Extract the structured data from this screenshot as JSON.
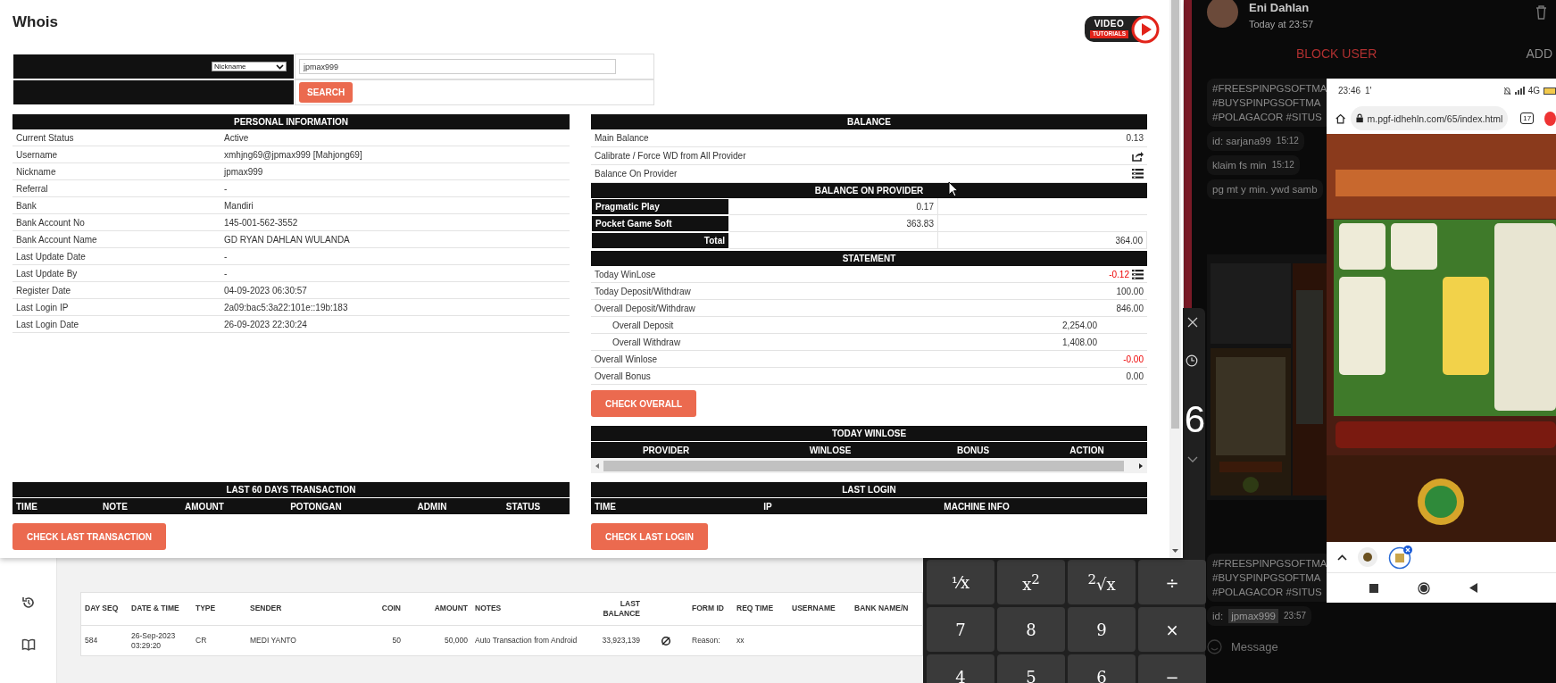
{
  "dialog": {
    "title": "Whois",
    "logo": {
      "top": "VIDEO",
      "bottom": "TUTORIALS"
    },
    "search": {
      "type": "Nickname",
      "value": "jpmax999",
      "button": "SEARCH"
    },
    "personal": {
      "title": "PERSONAL INFORMATION",
      "rows": [
        {
          "label": "Current Status",
          "value": "Active"
        },
        {
          "label": "Username",
          "value": "xmhjng69@jpmax999  [Mahjong69]"
        },
        {
          "label": "Nickname",
          "value": "jpmax999"
        },
        {
          "label": "Referral",
          "value": "-"
        },
        {
          "label": "Bank",
          "value": "Mandiri"
        },
        {
          "label": "Bank Account No",
          "value": "145-001-562-3552"
        },
        {
          "label": "Bank Account Name",
          "value": "GD RYAN DAHLAN WULANDA"
        },
        {
          "label": "Last Update Date",
          "value": "-"
        },
        {
          "label": "Last Update By",
          "value": "-"
        },
        {
          "label": "Register Date",
          "value": "04-09-2023 06:30:57"
        },
        {
          "label": "Last Login IP",
          "value": "2a09:bac5:3a22:101e::19b:183"
        },
        {
          "label": "Last Login Date",
          "value": "26-09-2023 22:30:24"
        }
      ]
    },
    "balance": {
      "title": "BALANCE",
      "rows": [
        {
          "kind": "value",
          "label": "Main Balance",
          "value": "0.13"
        },
        {
          "kind": "share",
          "label": "Calibrate / Force WD from All Provider"
        },
        {
          "kind": "list",
          "label": "Balance On Provider"
        }
      ]
    },
    "provider_balance": {
      "title": "BALANCE ON PROVIDER",
      "rows": [
        {
          "name": "Pragmatic Play",
          "value": "0.17"
        },
        {
          "name": "Pocket Game Soft",
          "value": "363.83"
        }
      ],
      "total_label": "Total",
      "total": "364.00"
    },
    "statement": {
      "title": "STATEMENT",
      "rows": [
        {
          "kind": "summary",
          "label": "Today WinLose",
          "value": "-0.12",
          "negative": true,
          "menu_icon": true
        },
        {
          "kind": "summary",
          "label": "Today Deposit/Withdraw",
          "value": "100.00",
          "negative": false,
          "menu_icon": false
        },
        {
          "kind": "summary",
          "label": "Overall Deposit/Withdraw",
          "value": "846.00",
          "negative": false,
          "menu_icon": false
        },
        {
          "kind": "detail",
          "label": "Overall Deposit",
          "value": "2,254.00",
          "negative": false,
          "menu_icon": false
        },
        {
          "kind": "detail",
          "label": "Overall Withdraw",
          "value": "1,408.00",
          "negative": false,
          "menu_icon": false
        },
        {
          "kind": "summary",
          "label": "Overall Winlose",
          "value": "-0.00",
          "negative": true,
          "menu_icon": false
        },
        {
          "kind": "summary",
          "label": "Overall Bonus",
          "value": "0.00",
          "negative": false,
          "menu_icon": false
        }
      ],
      "button": "CHECK OVERALL"
    },
    "today_winlose": {
      "title": "TODAY WINLOSE",
      "columns": [
        "PROVIDER",
        "WINLOSE",
        "BONUS",
        "ACTION"
      ]
    },
    "last_transactions": {
      "title": "LAST 60 DAYS TRANSACTION",
      "columns": [
        "TIME",
        "NOTE",
        "AMOUNT",
        "POTONGAN",
        "ADMIN",
        "STATUS"
      ],
      "button": "CHECK LAST TRANSACTION"
    },
    "last_login": {
      "title": "LAST LOGIN",
      "columns": [
        "TIME",
        "IP",
        "MACHINE INFO"
      ],
      "button": "CHECK LAST LOGIN"
    }
  },
  "transactions": {
    "columns": [
      "DAY SEQ",
      "DATE & TIME",
      "TYPE",
      "SENDER",
      "COIN",
      "AMOUNT",
      "NOTES",
      "LAST BALANCE",
      "FORM ID",
      "REQ TIME",
      "USERNAME",
      "BANK NAME/N"
    ],
    "rows": [
      {
        "cells": [
          "584",
          "26-Sep-2023 03:29:20",
          "CR",
          "MEDI YANTO",
          "50",
          "50,000",
          "Auto Transaction from Android",
          "33,923,139",
          "Reason:",
          "xx"
        ]
      }
    ]
  },
  "calculator": {
    "display": "6",
    "keys": [
      "¹⁄x",
      "x$^{2}$",
      "$^{2}$√x",
      "÷",
      "7",
      "8",
      "9",
      "×",
      "4",
      "5",
      "6",
      "−"
    ]
  },
  "chat": {
    "name": "Eni Dahlan",
    "time": "Today at 23:57",
    "actions": [
      "BLOCK USER",
      "ADD"
    ],
    "messages": [
      {
        "lines": [
          "#FREESPINPGSOFTMA",
          "#BUYSPINPGSOFTMA",
          "#POLAGACOR #SITUS"
        ]
      },
      {
        "lines": [
          "id: sarjana99"
        ],
        "time": "15:12"
      },
      {
        "lines": [
          "klaim fs min"
        ],
        "time": "15:12"
      },
      {
        "lines": [
          "pg mt y min. ywd samb"
        ]
      }
    ],
    "lower_messages": [
      {
        "lines": [
          "#FREESPINPGSOFTMA",
          "#BUYSPINPGSOFTMA",
          "#POLAGACOR #SITUS"
        ]
      },
      {
        "lines": [
          "id:"
        ],
        "hidden_text": "jpmax999",
        "time": "23:57"
      }
    ],
    "placeholder": "Message"
  },
  "phone": {
    "time": "23:46",
    "indicator": "1'",
    "network": "4G",
    "url": "m.pgf-idhehln.com/65/index.html",
    "tabs": "17"
  }
}
